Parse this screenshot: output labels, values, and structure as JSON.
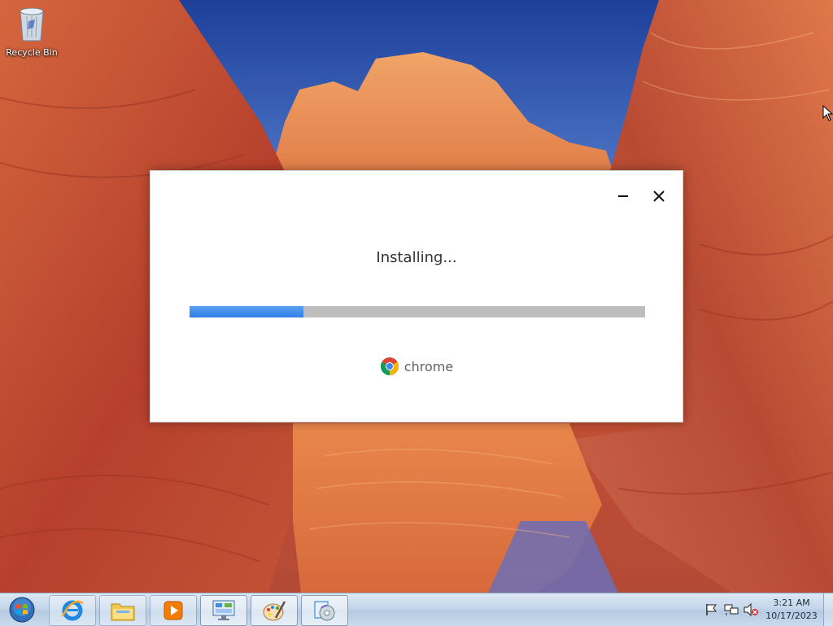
{
  "desktop": {
    "icons": [
      {
        "label": "Recycle Bin",
        "icon": "recycle-bin-icon"
      }
    ]
  },
  "installer": {
    "status": "Installing...",
    "progress_fraction": 0.25,
    "brand_name": "chrome",
    "brand_icon": "chrome-logo-icon",
    "window_buttons": [
      "minimize-icon",
      "close-icon"
    ]
  },
  "taskbar": {
    "start_icon": "windows-start-orb-icon",
    "items": [
      {
        "icon": "internet-explorer-icon",
        "state": "pinned"
      },
      {
        "icon": "file-explorer-icon",
        "state": "pinned"
      },
      {
        "icon": "media-player-icon",
        "state": "pinned"
      },
      {
        "icon": "control-panel-icon",
        "state": "running"
      },
      {
        "icon": "paint-icon",
        "state": "running"
      },
      {
        "icon": "installer-disc-icon",
        "state": "running"
      }
    ],
    "tray_icons": [
      "action-center-flag-icon",
      "network-icon",
      "volume-muted-icon"
    ],
    "clock": {
      "time": "3:21 AM",
      "date": "10/17/2023"
    }
  },
  "colors": {
    "progress_fill": "#2f7de6",
    "progress_track": "#bdbdbd",
    "sky": "#2c4fa3"
  }
}
